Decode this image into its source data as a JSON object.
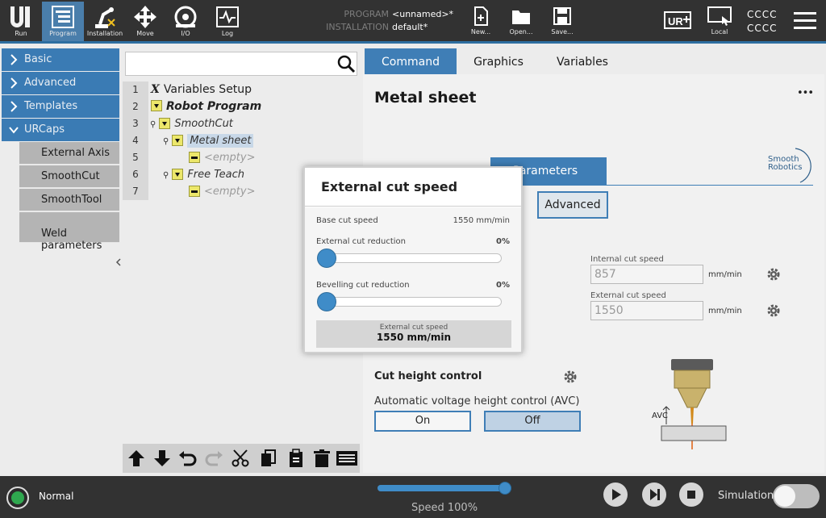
{
  "topbar": {
    "tabs": [
      {
        "label": "Run",
        "icon": "ur-logo-icon"
      },
      {
        "label": "Program",
        "icon": "program-icon"
      },
      {
        "label": "Installation",
        "icon": "robot-arm-icon"
      },
      {
        "label": "Move",
        "icon": "move-arrows-icon"
      },
      {
        "label": "I/O",
        "icon": "io-gauge-icon"
      },
      {
        "label": "Log",
        "icon": "log-chart-icon"
      }
    ],
    "program_key": "PROGRAM",
    "program_value": "<unnamed>*",
    "installation_key": "INSTALLATION",
    "installation_value": "default*",
    "new_label": "New...",
    "open_label": "Open...",
    "save_label": "Save...",
    "local_label": "Local",
    "cccc_1": "CCCC",
    "cccc_2": "CCCC"
  },
  "nav": {
    "basic": "Basic",
    "advanced": "Advanced",
    "templates": "Templates",
    "urcaps": "URCaps",
    "sub_items": [
      "External Axis",
      "SmoothCut",
      "SmoothTool",
      "Weld\nparameters"
    ]
  },
  "tree": {
    "line_numbers": [
      "1",
      "2",
      "3",
      "4",
      "5",
      "6",
      "7"
    ],
    "x_label": "X",
    "variables_setup": "Variables Setup",
    "robot_program": "Robot Program",
    "smoothcut": "SmoothCut",
    "metal_sheet": "Metal sheet",
    "empty_1": "<empty>",
    "free_teach": "Free Teach",
    "empty_2": "<empty>"
  },
  "right_tabs": {
    "command": "Command",
    "graphics": "Graphics",
    "variables": "Variables"
  },
  "content": {
    "title": "Metal sheet",
    "more": "•••",
    "params_tab": "Parameters",
    "advanced_btn": "Advanced",
    "brand_line1": "Smooth",
    "brand_line2": "Robotics",
    "internal_speed_label": "Internal cut speed",
    "internal_speed_value": "857",
    "external_speed_label": "External cut speed",
    "external_speed_value": "1550",
    "unit": "mm/min",
    "cut_height": "Cut height control",
    "avc_label": "Automatic voltage height control (AVC)",
    "on": "On",
    "off": "Off",
    "avc_short": "AVC"
  },
  "modal": {
    "title": "External cut speed",
    "base_speed_label": "Base cut speed",
    "base_speed_value": "1550 mm/min",
    "ext_reduction_label": "External cut reduction",
    "ext_reduction_value": "0%",
    "ext_reduction_level": 0,
    "bevel_reduction_label": "Bevelling cut reduction",
    "bevel_reduction_value": "0%",
    "bevel_reduction_level": 0,
    "result_label": "External cut speed",
    "result_value": "1550 mm/min"
  },
  "bottombar": {
    "status": "Normal",
    "speed": "Speed 100%",
    "speed_level": 1.0,
    "simulation": "Simulation"
  },
  "colors": {
    "accent": "#3f7eb6",
    "topbar": "#323232",
    "tree_highlight": "#c8d8e8",
    "status_green": "#2fa84f",
    "slider": "#3f8cc8"
  }
}
